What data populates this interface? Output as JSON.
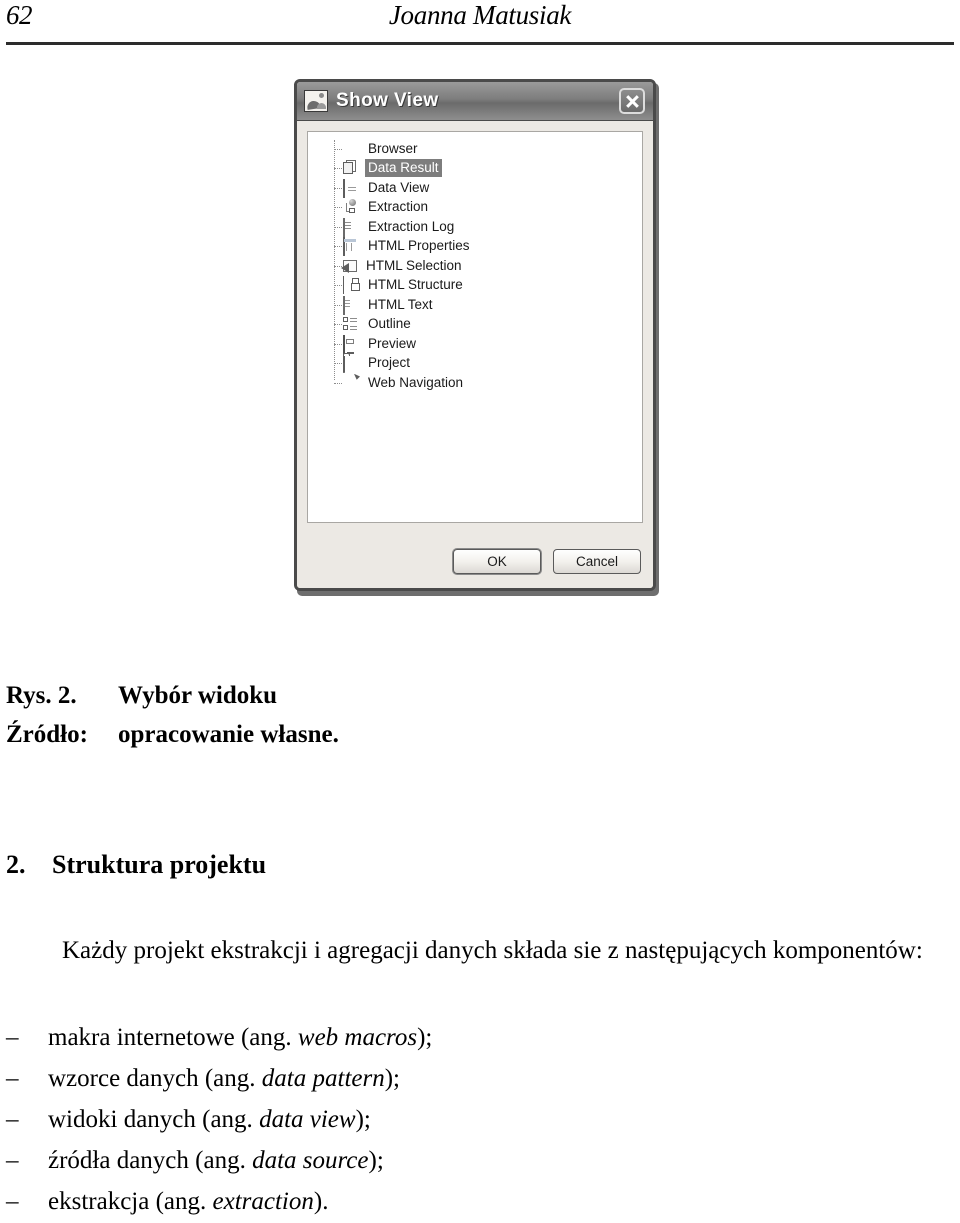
{
  "page": {
    "number": "62",
    "running_head": "Joanna Matusiak"
  },
  "figure": {
    "dialog": {
      "title": "Show View",
      "title_icon": "image-view-icon",
      "close_icon": "close-icon",
      "selected_item": "Data Result",
      "selection_bg": "#7d7d7d",
      "tree_items": [
        {
          "label": "Browser",
          "icon": "sphere-icon"
        },
        {
          "label": "Data Result",
          "icon": "document-stack-icon"
        },
        {
          "label": "Data View",
          "icon": "grid-icon"
        },
        {
          "label": "Extraction",
          "icon": "node-tree-icon"
        },
        {
          "label": "Extraction Log",
          "icon": "document-icon"
        },
        {
          "label": "HTML Properties",
          "icon": "table-icon"
        },
        {
          "label": "HTML Selection",
          "icon": "pointer-select-icon"
        },
        {
          "label": "HTML Structure",
          "icon": "tree-structure-icon"
        },
        {
          "label": "HTML Text",
          "icon": "text-document-icon"
        },
        {
          "label": "Outline",
          "icon": "outline-icon"
        },
        {
          "label": "Preview",
          "icon": "monitor-icon"
        },
        {
          "label": "Project",
          "icon": "folder-icon"
        },
        {
          "label": "Web Navigation",
          "icon": "globe-icon"
        }
      ],
      "buttons": {
        "ok": "OK",
        "cancel": "Cancel"
      }
    }
  },
  "caption": {
    "figure_label": "Rys. 2.",
    "figure_title": "Wybór widoku",
    "source_label": "Źródło:",
    "source_text": "opracowanie własne."
  },
  "section": {
    "number": "2.",
    "heading": "Struktura projektu",
    "paragraph": "Każdy projekt ekstrakcji i agregacji danych składa sie z następujących komponentów:",
    "bullets": [
      {
        "dash": "–",
        "text_before": "makra internetowe (ang. ",
        "term": "web macros",
        "text_after": ");"
      },
      {
        "dash": "–",
        "text_before": "wzorce danych (ang. ",
        "term": "data pattern",
        "text_after": ");"
      },
      {
        "dash": "–",
        "text_before": "widoki danych (ang. ",
        "term": "data view",
        "text_after": ");"
      },
      {
        "dash": "–",
        "text_before": "źródła danych (ang. ",
        "term": "data source",
        "text_after": ");"
      },
      {
        "dash": "–",
        "text_before": "ekstrakcja (ang. ",
        "term": "extraction",
        "text_after": ")."
      }
    ]
  }
}
